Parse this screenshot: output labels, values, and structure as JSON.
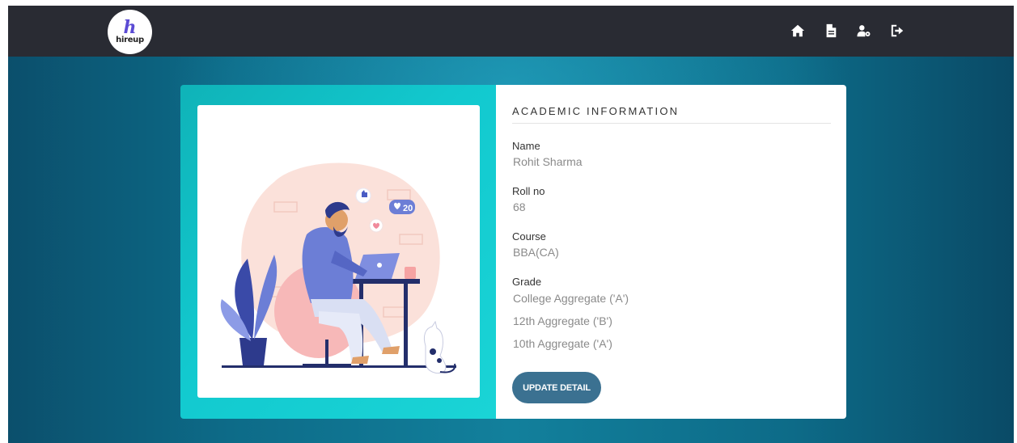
{
  "brand": {
    "logo_mark": "h",
    "logo_text": "hireup"
  },
  "nav": {
    "icons": [
      "home-icon",
      "document-icon",
      "user-settings-icon",
      "logout-icon"
    ]
  },
  "academic": {
    "title": "ACADEMIC INFORMATION",
    "name_label": "Name",
    "name_value": "Rohit Sharma",
    "roll_label": "Roll no",
    "roll_value": "68",
    "course_label": "Course",
    "course_value": "BBA(CA)",
    "grade_label": "Grade",
    "grades": [
      "College Aggregate ('A')",
      "12th Aggregate ('B')",
      "10th Aggregate ('A')"
    ],
    "update_label": "UPDATE DETAIL"
  },
  "illustration": {
    "likes_badge": "20"
  },
  "colors": {
    "navbar": "#292b33",
    "card_left_accent": "#12c9cf",
    "button": "#3b7191",
    "logo_accent": "#5b4bd4"
  }
}
